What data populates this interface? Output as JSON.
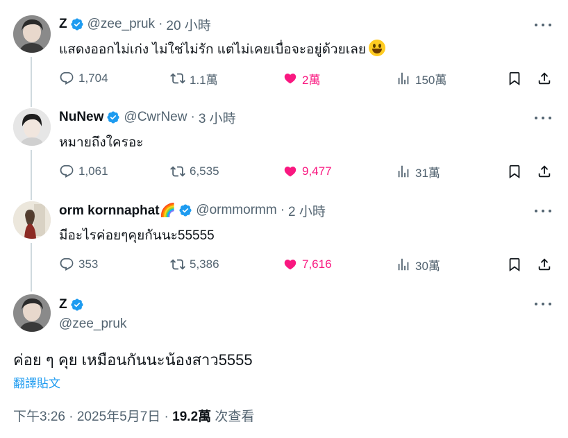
{
  "tweets": [
    {
      "name": "Z",
      "handle": "@zee_pruk",
      "time": "20 小時",
      "text": "แสดงออกไม่เก่ง ไม่ใช่ไม่รัก แต่ไม่เคยเบื่อจะอยู่ด้วยเลย",
      "replies": "1,704",
      "retweets": "1.1萬",
      "likes": "2萬",
      "views": "150萬"
    },
    {
      "name": "NuNew",
      "handle": "@CwrNew",
      "time": "3 小時",
      "text": "หมายถึงใครอะ",
      "replies": "1,061",
      "retweets": "6,535",
      "likes": "9,477",
      "views": "31萬"
    },
    {
      "name": "orm kornnaphat🌈",
      "handle": "@ormmormm",
      "time": "2 小時",
      "text": "มีอะไรค่อยๆคุยกันนะ55555",
      "replies": "353",
      "retweets": "5,386",
      "likes": "7,616",
      "views": "30萬"
    }
  ],
  "main": {
    "name": "Z",
    "handle": "@zee_pruk",
    "text": "ค่อย ๆ คุย เหมือนกันนะน้องสาว5555",
    "translate": "翻譯貼文",
    "date": "下午3:26 · 2025年5月7日 · ",
    "views": "19.2萬",
    "views_label": " 次查看"
  },
  "colors": {
    "verified": "#1d9bf0",
    "like": "#f91880",
    "secondary_text": "#536471",
    "thread_line": "#cfd9de"
  },
  "icons": [
    "reply-icon",
    "retweet-icon",
    "like-icon",
    "views-icon",
    "bookmark-icon",
    "share-icon",
    "verified-icon",
    "more-icon"
  ]
}
